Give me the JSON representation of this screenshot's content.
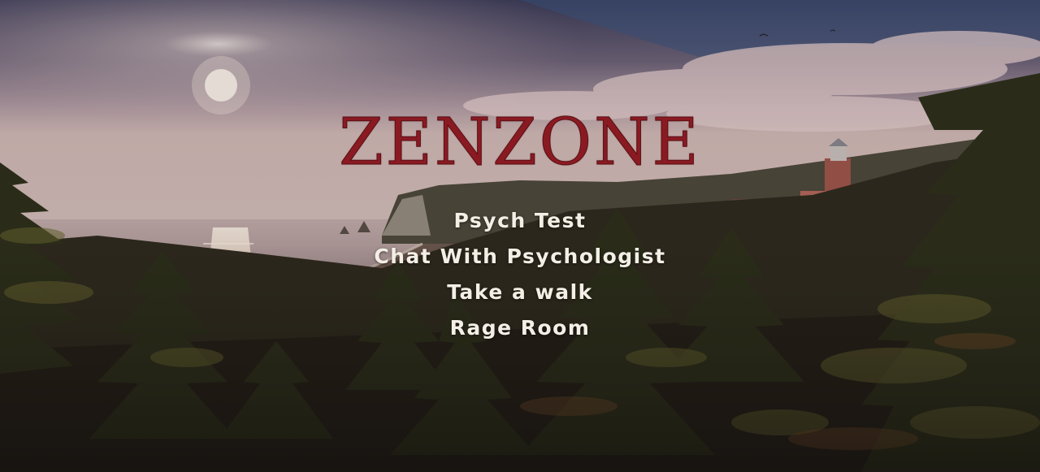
{
  "game": {
    "title": "ZENZONE"
  },
  "menu": {
    "items": [
      {
        "label": "Psych Test"
      },
      {
        "label": "Chat With Psychologist"
      },
      {
        "label": "Take a walk"
      },
      {
        "label": "Rage Room"
      }
    ]
  },
  "colors": {
    "title": "#8a1a22",
    "menu_text": "#f4efe6",
    "sky_top": "#3e3f5a",
    "sky_glow": "#d8c2bf",
    "sea": "#b9a7a6",
    "forest": "#2a2415"
  },
  "background": {
    "scene": "coastal sunset with pine forest, lighthouse and ocean"
  }
}
